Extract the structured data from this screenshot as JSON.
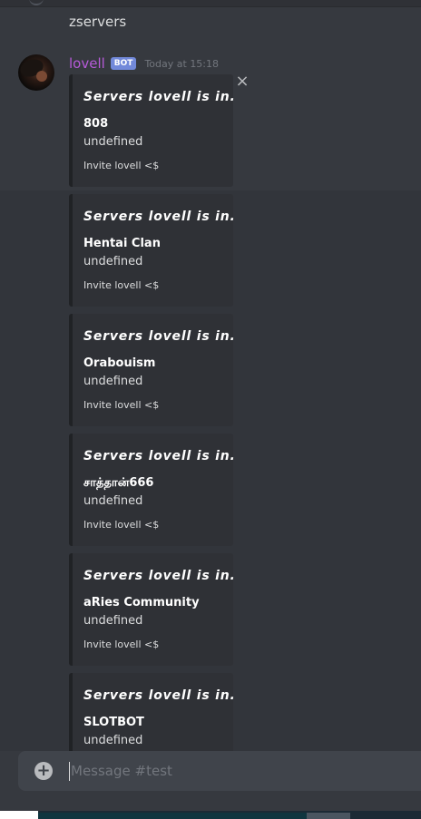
{
  "previous_message": {
    "text": "zservers"
  },
  "message": {
    "username": "lovell",
    "bot_tag": "BOT",
    "timestamp": "Today at 15:18",
    "close_glyph": "×"
  },
  "embeds": [
    {
      "title": "Servers lovell is in.",
      "field_name": "808",
      "field_value": "undefined",
      "footer": "Invite lovell <$"
    },
    {
      "title": "Servers lovell is in.",
      "field_name": "Hentai Clan",
      "field_value": "undefined",
      "footer": "Invite lovell <$"
    },
    {
      "title": "Servers lovell is in.",
      "field_name": "Orabouism",
      "field_value": "undefined",
      "footer": "Invite lovell <$"
    },
    {
      "title": "Servers lovell is in.",
      "field_name": "சாத்தான்666",
      "field_value": "undefined",
      "footer": "Invite lovell <$"
    },
    {
      "title": "Servers lovell is in.",
      "field_name": "aRies Community",
      "field_value": "undefined",
      "footer": "Invite lovell <$"
    },
    {
      "title": "Servers lovell is in.",
      "field_name": "SLOTBOT",
      "field_value": "undefined",
      "footer": ""
    }
  ],
  "composer": {
    "placeholder": "Message #test",
    "upload_glyph": "+"
  },
  "colors": {
    "background": "#36393f",
    "username": "#b65ad8",
    "bot_tag": "#7289da",
    "embed_bg": "#2f3136",
    "composer_bg": "#40444b"
  },
  "icons": [
    "close-icon",
    "upload-plus-icon",
    "avatar"
  ]
}
